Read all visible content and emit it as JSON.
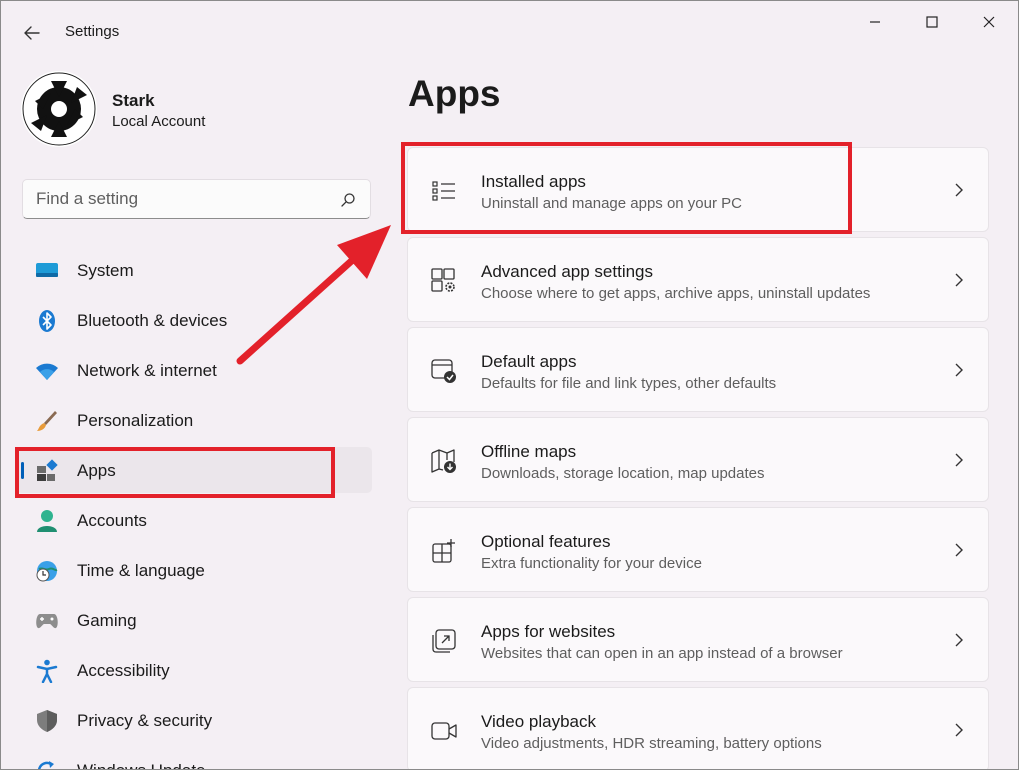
{
  "titlebar": {
    "app_title": "Settings",
    "back_icon": "arrow-left-icon",
    "controls": [
      "minimize-icon",
      "maximize-icon",
      "close-icon"
    ]
  },
  "profile": {
    "name": "Stark",
    "account_type": "Local Account"
  },
  "search": {
    "placeholder": "Find a setting",
    "icon": "search-icon"
  },
  "nav": {
    "items": [
      {
        "label": "System",
        "icon": "monitor-icon"
      },
      {
        "label": "Bluetooth & devices",
        "icon": "bluetooth-icon"
      },
      {
        "label": "Network & internet",
        "icon": "wifi-icon"
      },
      {
        "label": "Personalization",
        "icon": "paintbrush-icon"
      },
      {
        "label": "Apps",
        "icon": "apps-icon",
        "selected": true
      },
      {
        "label": "Accounts",
        "icon": "person-icon"
      },
      {
        "label": "Time & language",
        "icon": "globe-clock-icon"
      },
      {
        "label": "Gaming",
        "icon": "gamepad-icon"
      },
      {
        "label": "Accessibility",
        "icon": "accessibility-icon"
      },
      {
        "label": "Privacy & security",
        "icon": "shield-icon"
      },
      {
        "label": "Windows Update",
        "icon": "update-icon"
      }
    ]
  },
  "main": {
    "title": "Apps",
    "cards": [
      {
        "title": "Installed apps",
        "description": "Uninstall and manage apps on your PC",
        "icon": "list-icon"
      },
      {
        "title": "Advanced app settings",
        "description": "Choose where to get apps, archive apps, uninstall updates",
        "icon": "app-settings-icon"
      },
      {
        "title": "Default apps",
        "description": "Defaults for file and link types, other defaults",
        "icon": "default-apps-icon"
      },
      {
        "title": "Offline maps",
        "description": "Downloads, storage location, map updates",
        "icon": "map-download-icon"
      },
      {
        "title": "Optional features",
        "description": "Extra functionality for your device",
        "icon": "add-feature-icon"
      },
      {
        "title": "Apps for websites",
        "description": "Websites that can open in an app instead of a browser",
        "icon": "open-external-icon"
      },
      {
        "title": "Video playback",
        "description": "Video adjustments, HDR streaming, battery options",
        "icon": "video-icon"
      }
    ]
  },
  "colors": {
    "accent": "#005fb8",
    "annotation_red": "#e3212a",
    "window_bg": "#f4eff4",
    "card_bg": "#fbf9fb"
  }
}
